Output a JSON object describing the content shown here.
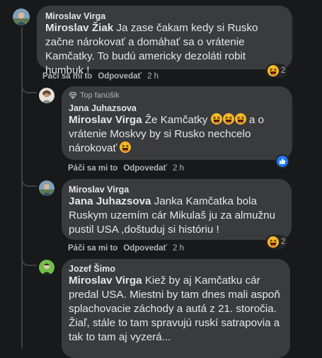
{
  "comments": [
    {
      "author": "Miroslav Virga",
      "mention": "Miroslav Žiak",
      "text": " Ja zase čakam kedy si Rusko začne nárokovať a domáhať sa o vrátenie Kamčatky. To budú americky dezoláti robit humbuk !",
      "like": "Páči sa mi to",
      "reply": "Odpovedať",
      "time": "2 h",
      "reaction_count": "2",
      "reaction": "haha"
    },
    {
      "badge": "Top fanúšik",
      "author": "Jana Juhazsova",
      "mention": "Miroslav Virga",
      "text_before": " Že Kamčatky ",
      "text_after": " a o vrátenie Moskvy by si Rusko nechcelo nárokovať ",
      "like": "Páči sa mi to",
      "reply": "Odpovedať",
      "time": "2 h",
      "reaction": "like"
    },
    {
      "author": "Miroslav Virga",
      "mention": "Jana Juhazsova",
      "text": " Janka Kamčatka bola Ruskym uzemím cár Mikulaš ju za almužnu pustil USA ,doštuduj si históriu !",
      "like": "Páči sa mi to",
      "reply": "Odpovedať",
      "time": "2 h",
      "reaction_count": "2",
      "reaction": "haha"
    },
    {
      "author": "Jozef Šimo",
      "mention": "Miroslav Virga",
      "text": " Kiež by aj Kamčatku cár predal USA. Miestni by tam dnes mali aspoň splachovacie záchody a autá z 21. storočia. Žiaľ, stále to tam spravujú ruskí satrapovia a tak to tam aj vyzerá..."
    }
  ],
  "colors": {
    "background": "#18191a",
    "bubble": "#3a3b3c",
    "text": "#e4e6eb",
    "secondary": "#b0b3b8",
    "like_blue": "#2078f4",
    "haha_yellow": "#f7b928"
  }
}
